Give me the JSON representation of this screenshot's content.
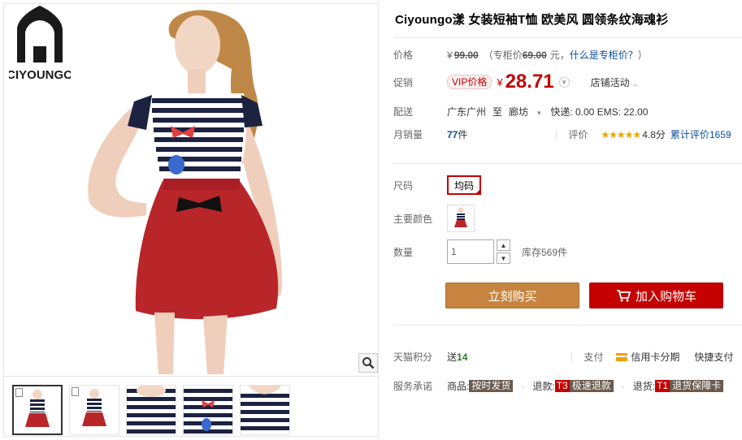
{
  "brand": {
    "logo_text": "CIYOUNGO"
  },
  "product": {
    "title": "Ciyoungo漾 女装短袖T恤 欧美风 圆领条纹海魂衫"
  },
  "price": {
    "label": "价格",
    "yen": "¥",
    "original": "99.00",
    "counter_prefix": "（专柜价",
    "counter_value": "69.00",
    "counter_suffix": "元，",
    "counter_link": "什么是专柜价？",
    "close_paren": "）"
  },
  "promo": {
    "label": "促销",
    "vip_badge": "VIP价格",
    "yen": "¥",
    "price": "28.71",
    "shop_activity": "店铺活动"
  },
  "delivery": {
    "label": "配送",
    "from": "广东广州",
    "to_word": "至",
    "destination": "廊坊",
    "shipping": "快递: 0.00  EMS: 22.00"
  },
  "sales": {
    "label": "月销量",
    "count": "77",
    "unit": "件",
    "rating_label": "评价",
    "stars": "★★★★★",
    "score": "4.8分",
    "cumulative": "累计评价1659"
  },
  "options": {
    "size_label": "尺码",
    "size_value": "均码",
    "color_label": "主要颜色"
  },
  "quantity": {
    "label": "数量",
    "value": "1",
    "stock": "库存569件"
  },
  "actions": {
    "buy_now": "立刻购买",
    "add_cart": "加入购物车"
  },
  "points": {
    "label": "天猫积分",
    "give_prefix": "送",
    "give_value": "14",
    "pay_label": "支付",
    "credit_installment": "信用卡分期",
    "quick_pay": "快捷支付"
  },
  "service": {
    "label": "服务承诺",
    "goods_prefix": "商品:",
    "goods_tag": "按时发货",
    "refund_prefix": "退款:",
    "refund_code": "T3",
    "refund_tag": "极速退款",
    "return_prefix": "退货:",
    "return_code": "T1",
    "return_tag": "退货保障卡"
  },
  "colors": {
    "accent_red": "#c40000",
    "buy_orange": "#c7843f"
  }
}
